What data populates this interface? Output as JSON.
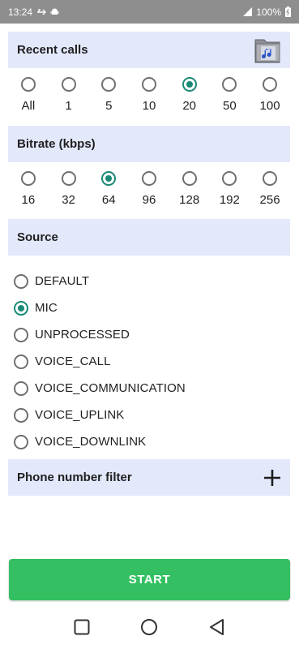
{
  "status_bar": {
    "time": "13:24",
    "battery": "100%"
  },
  "recent_calls": {
    "title": "Recent calls",
    "options": [
      "All",
      "1",
      "5",
      "10",
      "20",
      "50",
      "100"
    ],
    "selected": "20"
  },
  "bitrate": {
    "title": "Bitrate (kbps)",
    "options": [
      "16",
      "32",
      "64",
      "96",
      "128",
      "192",
      "256"
    ],
    "selected": "64"
  },
  "source": {
    "title": "Source",
    "options": [
      "DEFAULT",
      "MIC",
      "UNPROCESSED",
      "VOICE_CALL",
      "VOICE_COMMUNICATION",
      "VOICE_UPLINK",
      "VOICE_DOWNLINK"
    ],
    "selected": "MIC"
  },
  "phone_filter": {
    "title": "Phone number filter"
  },
  "start_button": {
    "label": "START"
  },
  "colors": {
    "header_bg": "#e3e8fb",
    "accent": "#1a8a75",
    "start": "#34c062",
    "status_bar": "#8e8e8e"
  },
  "icons": [
    "android-debug-icon",
    "usb-icon",
    "signal-icon",
    "battery-icon",
    "music-folder-icon",
    "plus-icon",
    "recents-icon",
    "home-icon",
    "back-icon"
  ]
}
